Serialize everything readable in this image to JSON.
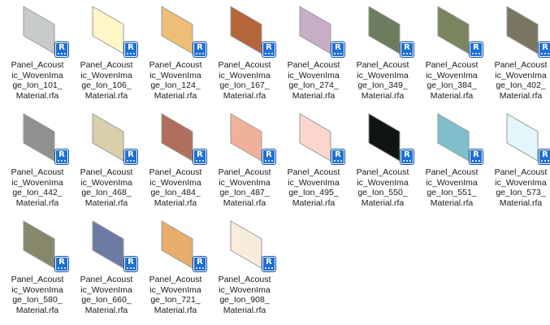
{
  "badge_letter": "R",
  "files": [
    {
      "name_lines": [
        "Panel_Acoust",
        "ic_WovenIma",
        "ge_Ion_101_",
        "Material.rfa"
      ],
      "color": "#c8ccc9"
    },
    {
      "name_lines": [
        "Panel_Acoust",
        "ic_WovenIma",
        "ge_Ion_106_",
        "Material.rfa"
      ],
      "color": "#fdf7c8"
    },
    {
      "name_lines": [
        "Panel_Acoust",
        "ic_WovenIma",
        "ge_Ion_124_",
        "Material.rfa"
      ],
      "color": "#eebd76"
    },
    {
      "name_lines": [
        "Panel_Acoust",
        "ic_WovenIma",
        "ge_Ion_167_",
        "Material.rfa"
      ],
      "color": "#b5653a"
    },
    {
      "name_lines": [
        "Panel_Acoust",
        "ic_WovenIma",
        "ge_Ion_274_",
        "Material.rfa"
      ],
      "color": "#c7aec5"
    },
    {
      "name_lines": [
        "Panel_Acoust",
        "ic_WovenIma",
        "ge_Ion_349_",
        "Material.rfa"
      ],
      "color": "#6b7d5e"
    },
    {
      "name_lines": [
        "Panel_Acoust",
        "ic_WovenIma",
        "ge_Ion_384_",
        "Material.rfa"
      ],
      "color": "#7a8560"
    },
    {
      "name_lines": [
        "Panel_Acoust",
        "ic_WovenIma",
        "ge_Ion_402_",
        "Material.rfa"
      ],
      "color": "#7b7564"
    },
    {
      "name_lines": [
        "Panel_Acoust",
        "ic_WovenIma",
        "ge_Ion_442_",
        "Material.rfa"
      ],
      "color": "#8f918e"
    },
    {
      "name_lines": [
        "Panel_Acoust",
        "ic_WovenIma",
        "ge_Ion_468_",
        "Material.rfa"
      ],
      "color": "#d8cfad"
    },
    {
      "name_lines": [
        "Panel_Acoust",
        "ic_WovenIma",
        "ge_Ion_484_",
        "Material.rfa"
      ],
      "color": "#b06f5c"
    },
    {
      "name_lines": [
        "Panel_Acoust",
        "ic_WovenIma",
        "ge_Ion_487_",
        "Material.rfa"
      ],
      "color": "#f0b19a"
    },
    {
      "name_lines": [
        "Panel_Acoust",
        "ic_WovenIma",
        "ge_Ion_495_",
        "Material.rfa"
      ],
      "color": "#fad6cd"
    },
    {
      "name_lines": [
        "Panel_Acoust",
        "ic_WovenIma",
        "ge_Ion_550_",
        "Material.rfa"
      ],
      "color": "#101512"
    },
    {
      "name_lines": [
        "Panel_Acoust",
        "ic_WovenIma",
        "ge_Ion_551_",
        "Material.rfa"
      ],
      "color": "#7fbfcb"
    },
    {
      "name_lines": [
        "Panel_Acoust",
        "ic_WovenIma",
        "ge_Ion_573_",
        "Material.rfa"
      ],
      "color": "#e4f6fb"
    },
    {
      "name_lines": [
        "Panel_Acoust",
        "ic_WovenIma",
        "ge_Ion_580_",
        "Material.rfa"
      ],
      "color": "#87876c"
    },
    {
      "name_lines": [
        "Panel_Acoust",
        "ic_WovenIma",
        "ge_Ion_660_",
        "Material.rfa"
      ],
      "color": "#6d7aa3"
    },
    {
      "name_lines": [
        "Panel_Acoust",
        "ic_WovenIma",
        "ge_Ion_721_",
        "Material.rfa"
      ],
      "color": "#e6ad6d"
    },
    {
      "name_lines": [
        "Panel_Acoust",
        "ic_WovenIma",
        "ge_Ion_908_",
        "Material.rfa"
      ],
      "color": "#f8eddc"
    }
  ]
}
